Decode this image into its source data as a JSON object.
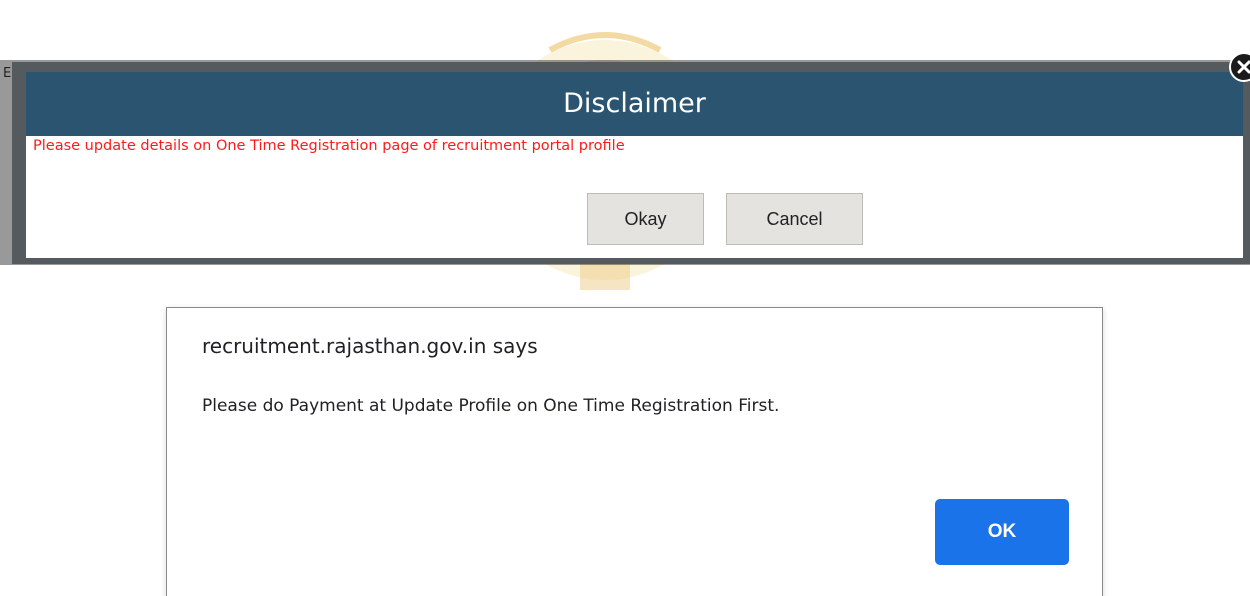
{
  "disclaimer": {
    "title": "Disclaimer",
    "message": "Please update details on One Time Registration page of recruitment portal profile",
    "okay_label": "Okay",
    "cancel_label": "Cancel"
  },
  "alert": {
    "title": "recruitment.rajasthan.gov.in says",
    "message": "Please do Payment at Update Profile on One Time Registration First.",
    "ok_label": "OK"
  },
  "colors": {
    "header_bg": "#2a5470",
    "message_text": "#ff1a1a",
    "ok_button": "#1a73e8"
  },
  "icons": {
    "close": "close-icon",
    "emblem": "state-emblem-icon"
  }
}
